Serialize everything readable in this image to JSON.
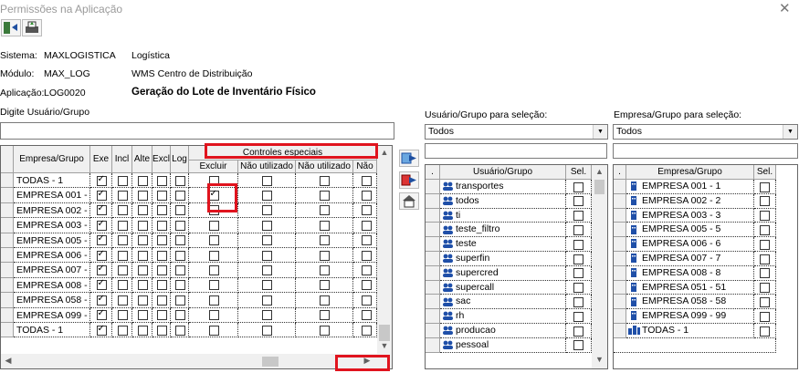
{
  "window": {
    "title": "Permissões na Aplicação"
  },
  "toolbar": {
    "save_icon": "door-exit-icon",
    "print_icon": "printer-icon"
  },
  "info": {
    "sistema_label": "Sistema:",
    "sistema_code": "MAXLOGISTICA",
    "sistema_name": "Logística",
    "modulo_label": "Módulo:",
    "modulo_code": "MAX_LOG",
    "modulo_name": "WMS Centro de Distribuição",
    "aplicacao_label": "Aplicação:",
    "aplicacao_code": "LOG0020",
    "aplicacao_name": "Geração do Lote de Inventário Físico"
  },
  "search": {
    "label": "Digite Usuário/Grupo",
    "value": ""
  },
  "permissions": {
    "super_header": "Controles especiais",
    "columns": [
      "Empresa/Grupo",
      "Exe",
      "Incl",
      "Alte",
      "Excl",
      "Log"
    ],
    "special_columns": [
      "Excluir",
      "Não utilizado",
      "Não utilizado",
      "Não"
    ],
    "rows": [
      {
        "name": "TODAS - 1",
        "exe": true,
        "special1": false
      },
      {
        "name": "EMPRESA 001 -",
        "exe": true,
        "special1": true
      },
      {
        "name": "EMPRESA 002 -",
        "exe": true,
        "special1": false
      },
      {
        "name": "EMPRESA 003 -",
        "exe": true,
        "special1": false
      },
      {
        "name": "EMPRESA 005 -",
        "exe": true,
        "special1": false
      },
      {
        "name": "EMPRESA 006 -",
        "exe": true,
        "special1": false
      },
      {
        "name": "EMPRESA 007 -",
        "exe": true,
        "special1": false
      },
      {
        "name": "EMPRESA 008 -",
        "exe": true,
        "special1": false
      },
      {
        "name": "EMPRESA 058 -",
        "exe": true,
        "special1": false
      },
      {
        "name": "EMPRESA 099 -",
        "exe": true,
        "special1": false
      },
      {
        "name": "TODAS - 1",
        "exe": true,
        "special1": false
      }
    ]
  },
  "users": {
    "label": "Usuário/Grupo para seleção:",
    "filter_value": "Todos",
    "search_value": "",
    "col_dot": ".",
    "col_name": "Usuário/Grupo",
    "col_sel": "Sel.",
    "items": [
      "transportes",
      "todos",
      "ti",
      "teste_filtro",
      "teste",
      "superfin",
      "supercred",
      "supercall",
      "sac",
      "rh",
      "producao",
      "pessoal"
    ]
  },
  "empresas": {
    "label": "Empresa/Grupo para seleção:",
    "filter_value": "Todos",
    "search_value": "",
    "col_dot": ".",
    "col_name": "Empresa/Grupo",
    "col_sel": "Sel.",
    "items": [
      "EMPRESA 001 - 1",
      "EMPRESA 002 - 2",
      "EMPRESA 003 - 3",
      "EMPRESA 005 - 5",
      "EMPRESA 006 - 6",
      "EMPRESA 007 - 7",
      "EMPRESA 008 - 8",
      "EMPRESA 051 - 51",
      "EMPRESA 058 - 58",
      "EMPRESA 099 - 99",
      "TODAS - 1"
    ]
  },
  "colors": {
    "highlight_red": "#e0141e",
    "user_icon": "#1f4fa8"
  }
}
